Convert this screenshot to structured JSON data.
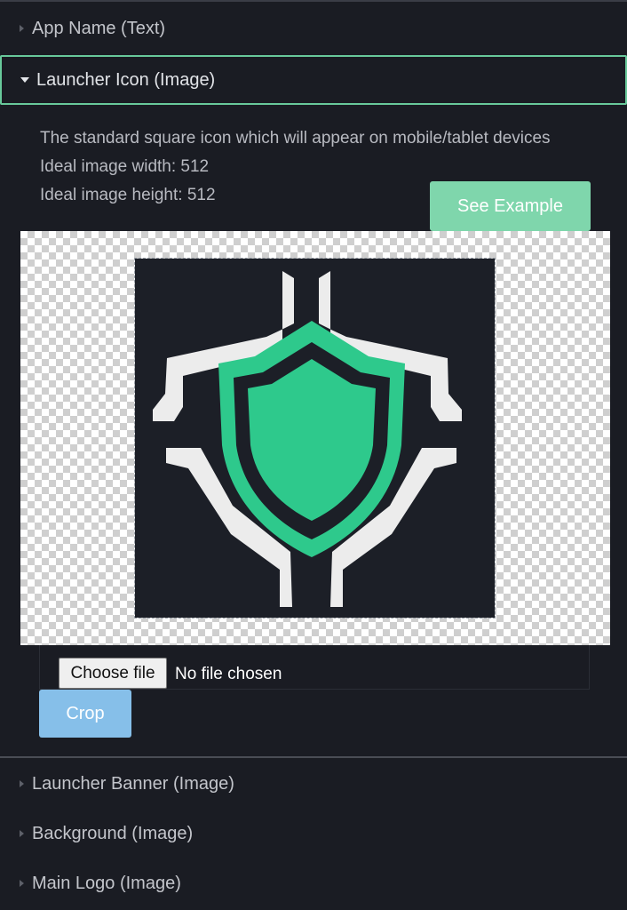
{
  "sections": [
    {
      "label": "App Name (Text)",
      "expanded": false
    },
    {
      "label": "Launcher Icon (Image)",
      "expanded": true
    },
    {
      "label": "Launcher Banner (Image)",
      "expanded": false
    },
    {
      "label": "Background (Image)",
      "expanded": false
    },
    {
      "label": "Main Logo (Image)",
      "expanded": false
    }
  ],
  "launcher_icon": {
    "description": "The standard square icon which will appear on mobile/tablet devices",
    "ideal_width": "Ideal image width: 512",
    "ideal_height": "Ideal image height: 512",
    "see_example_label": "See Example",
    "preview_icon": "shield-icon",
    "choose_file_label": "Choose file",
    "file_status": "No file chosen",
    "crop_label": "Crop"
  },
  "colors": {
    "background": "#1a1c23",
    "accent_green": "#2ec98c",
    "see_example_bg": "#7fd6ac",
    "crop_bg": "#86bfe9",
    "open_border": "#68c99b"
  }
}
